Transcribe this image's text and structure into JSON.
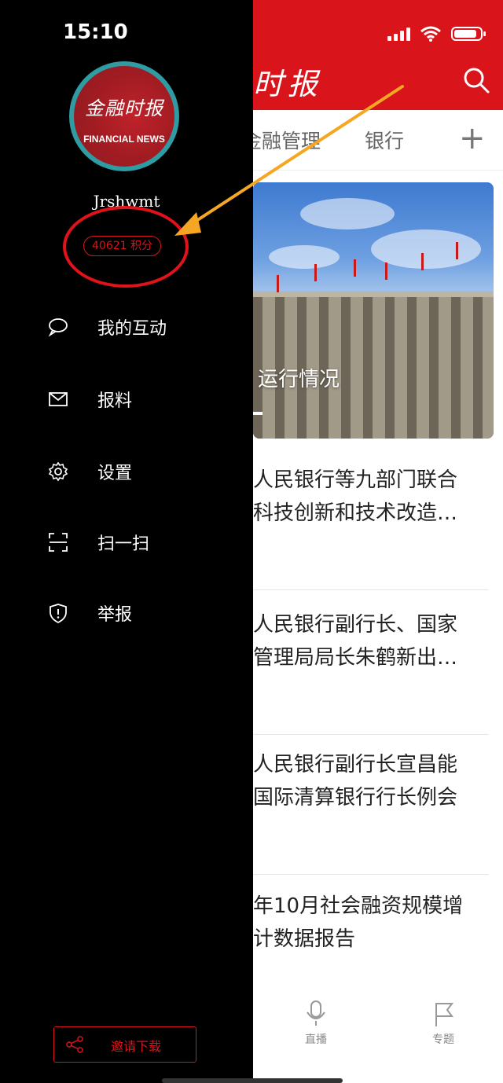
{
  "status_bar": {
    "time": "15:10"
  },
  "drawer": {
    "logo": {
      "cn_text": "金融时报",
      "en_text": "FINANCIAL NEWS"
    },
    "username": "Jrshwmt",
    "points": "40621 积分",
    "menu": [
      {
        "label": "我的互动",
        "icon": "chat-bubble-icon"
      },
      {
        "label": "报料",
        "icon": "mail-icon"
      },
      {
        "label": "设置",
        "icon": "gear-icon"
      },
      {
        "label": "扫一扫",
        "icon": "scan-icon"
      },
      {
        "label": "举报",
        "icon": "shield-alert-icon"
      }
    ],
    "invite_label": "邀请下载"
  },
  "app": {
    "masthead": "时报",
    "tabs": [
      "金融管理",
      "银行"
    ],
    "hero_caption": "运行情况",
    "news": [
      {
        "line1": "人民银行等九部门联合",
        "line2": "科技创新和技术改造…"
      },
      {
        "line1": "人民银行副行长、国家",
        "line2": "管理局局长朱鹤新出…"
      },
      {
        "line1": "人民银行副行长宣昌能",
        "line2": "国际清算银行行长例会"
      },
      {
        "line1": "年10月社会融资规模增",
        "line2": "计数据报告"
      }
    ],
    "bottom_nav": [
      {
        "label": "直播",
        "icon": "microphone-icon"
      },
      {
        "label": "专题",
        "icon": "flag-icon"
      }
    ]
  },
  "colors": {
    "brand_red": "#d9141b",
    "drawer_bg": "#000000",
    "annotation_arrow": "#f5a623"
  }
}
